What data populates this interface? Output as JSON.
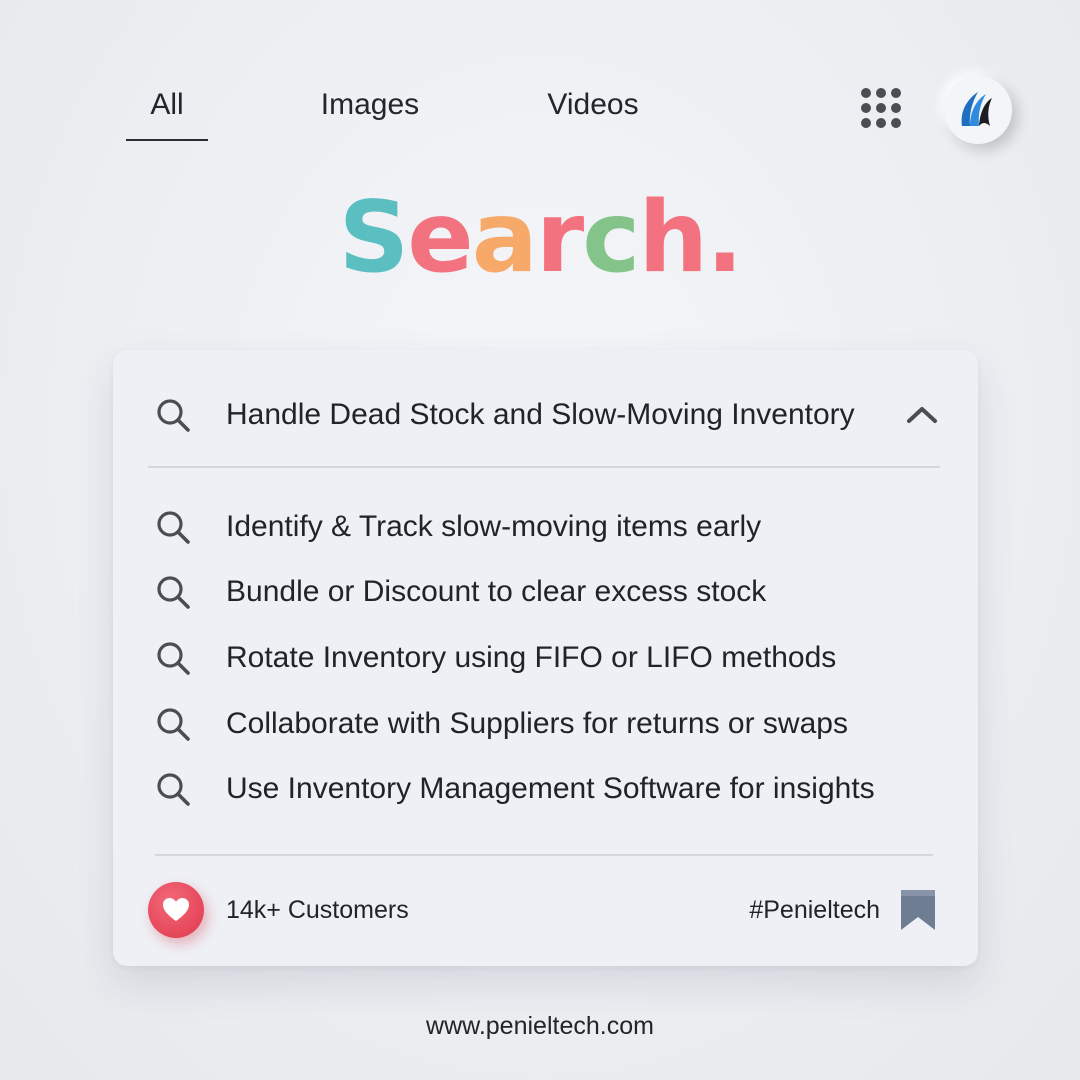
{
  "nav": {
    "tabs": [
      {
        "label": "All",
        "active": true
      },
      {
        "label": "Images",
        "active": false
      },
      {
        "label": "Videos",
        "active": false
      }
    ],
    "apps_icon": "apps-grid-icon",
    "logo_icon": "brand-logo-icon"
  },
  "hero": {
    "letters": [
      "S",
      "e",
      "a",
      "r",
      "c",
      "h",
      "."
    ],
    "colors": [
      "#5bbfc2",
      "#f2737f",
      "#f7a96a",
      "#f2737f",
      "#84c48a",
      "#f2737f",
      "#f2737f"
    ]
  },
  "card": {
    "query": "Handle Dead Stock and Slow-Moving Inventory",
    "suggestions": [
      "Identify & Track slow-moving items early",
      "Bundle or Discount to clear excess stock",
      "Rotate Inventory using FIFO or LIFO methods",
      "Collaborate with Suppliers for returns or swaps",
      "Use Inventory Management Software for insights"
    ],
    "footer": {
      "customers": "14k+ Customers",
      "hashtag": "#Penieltech"
    }
  },
  "website": "www.penieltech.com",
  "colors": {
    "heart": "#e74b5d",
    "bookmark": "#6f7d92",
    "icon_gray": "#4a4d53"
  }
}
